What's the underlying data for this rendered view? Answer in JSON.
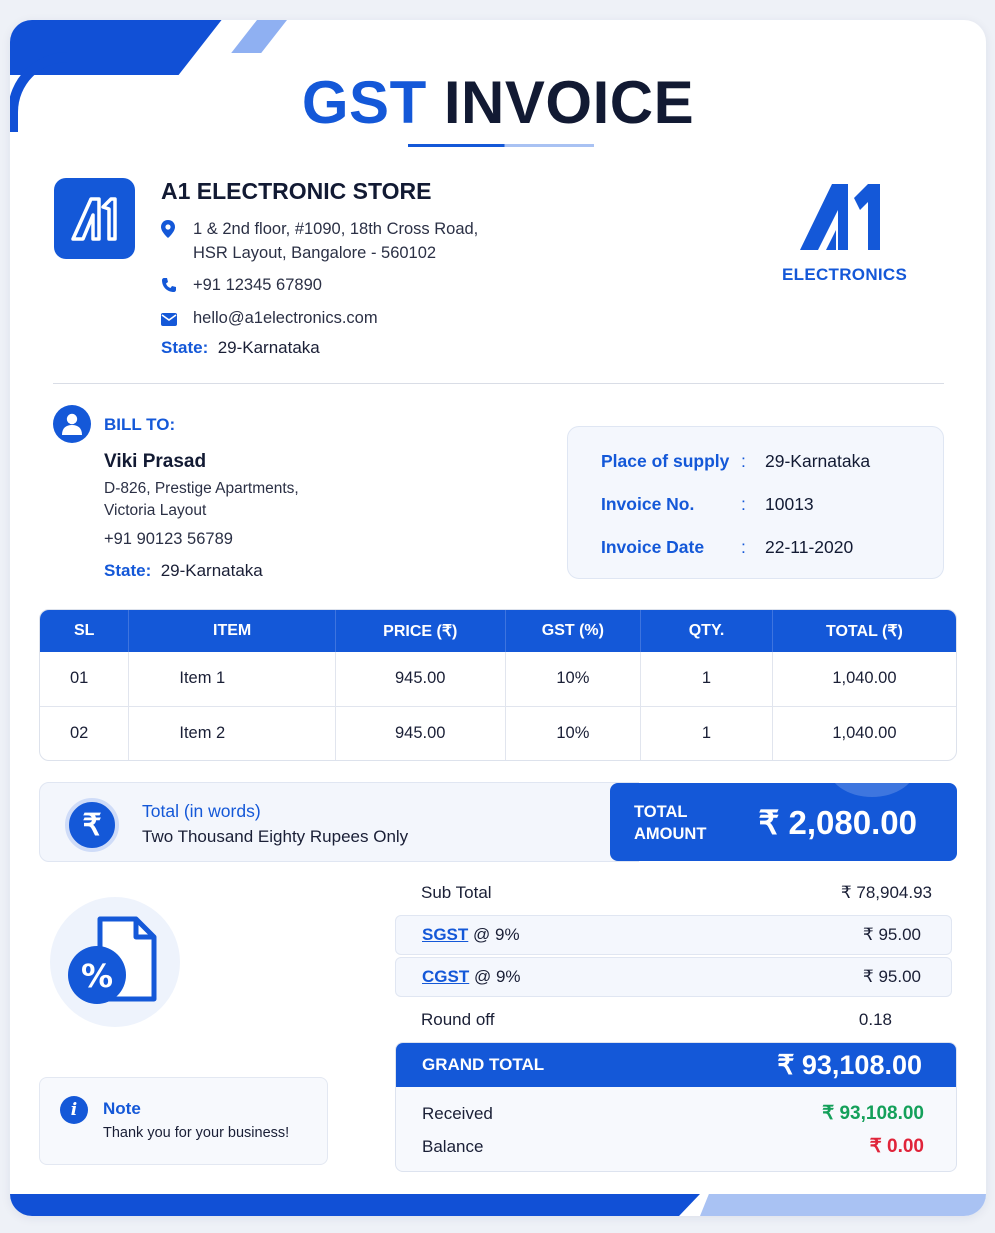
{
  "title": {
    "part1": "GST",
    "part2": "INVOICE"
  },
  "company": {
    "name": "A1 ELECTRONIC STORE",
    "address_line1": "1 & 2nd floor, #1090, 18th Cross Road,",
    "address_line2": "HSR Layout, Bangalore - 560102",
    "phone": "+91 12345 67890",
    "email": "hello@a1electronics.com",
    "state_label": "State:",
    "state_value": "29-Karnataka",
    "brand_text": "ELECTRONICS"
  },
  "bill_to": {
    "label": "BILL TO:",
    "name": "Viki Prasad",
    "address_line1": "D-826, Prestige Apartments,",
    "address_line2": "Victoria Layout",
    "phone": "+91 90123 56789",
    "state_label": "State:",
    "state_value": "29-Karnataka"
  },
  "meta": [
    {
      "label": "Place of supply",
      "sep": ":",
      "value": "29-Karnataka"
    },
    {
      "label": "Invoice No.",
      "sep": ":",
      "value": "10013"
    },
    {
      "label": "Invoice Date",
      "sep": ":",
      "value": "22-11-2020"
    }
  ],
  "table": {
    "headers": [
      "SL",
      "ITEM",
      "PRICE (₹)",
      "GST (%)",
      "QTY.",
      "TOTAL (₹)"
    ],
    "rows": [
      [
        "01",
        "Item 1",
        "945.00",
        "10%",
        "1",
        "1,040.00"
      ],
      [
        "02",
        "Item 2",
        "945.00",
        "10%",
        "1",
        "1,040.00"
      ]
    ]
  },
  "words": {
    "symbol": "₹",
    "label": "Total (in words)",
    "value": "Two Thousand Eighty Rupees Only"
  },
  "total": {
    "label_line1": "TOTAL",
    "label_line2": "AMOUNT",
    "amount": "₹ 2,080.00"
  },
  "summary": {
    "subtotal_label": "Sub Total",
    "subtotal_value": "₹ 78,904.93",
    "sgst_link": "SGST",
    "sgst_rate": "@ 9%",
    "sgst_value": "₹ 95.00",
    "cgst_link": "CGST",
    "cgst_rate": "@ 9%",
    "cgst_value": "₹ 95.00",
    "roundoff_label": "Round off",
    "roundoff_value": "0.18",
    "grand_label": "GRAND TOTAL",
    "grand_value": "₹ 93,108.00",
    "received_label": "Received",
    "received_value": "₹ 93,108.00",
    "balance_label": "Balance",
    "balance_value": "₹ 0.00"
  },
  "note": {
    "icon": "i",
    "title": "Note",
    "text": "Thank you for your business!"
  },
  "colors": {
    "primary": "#1458d8",
    "light": "#a9c2f3",
    "green": "#14a05a",
    "red": "#e0243a"
  }
}
